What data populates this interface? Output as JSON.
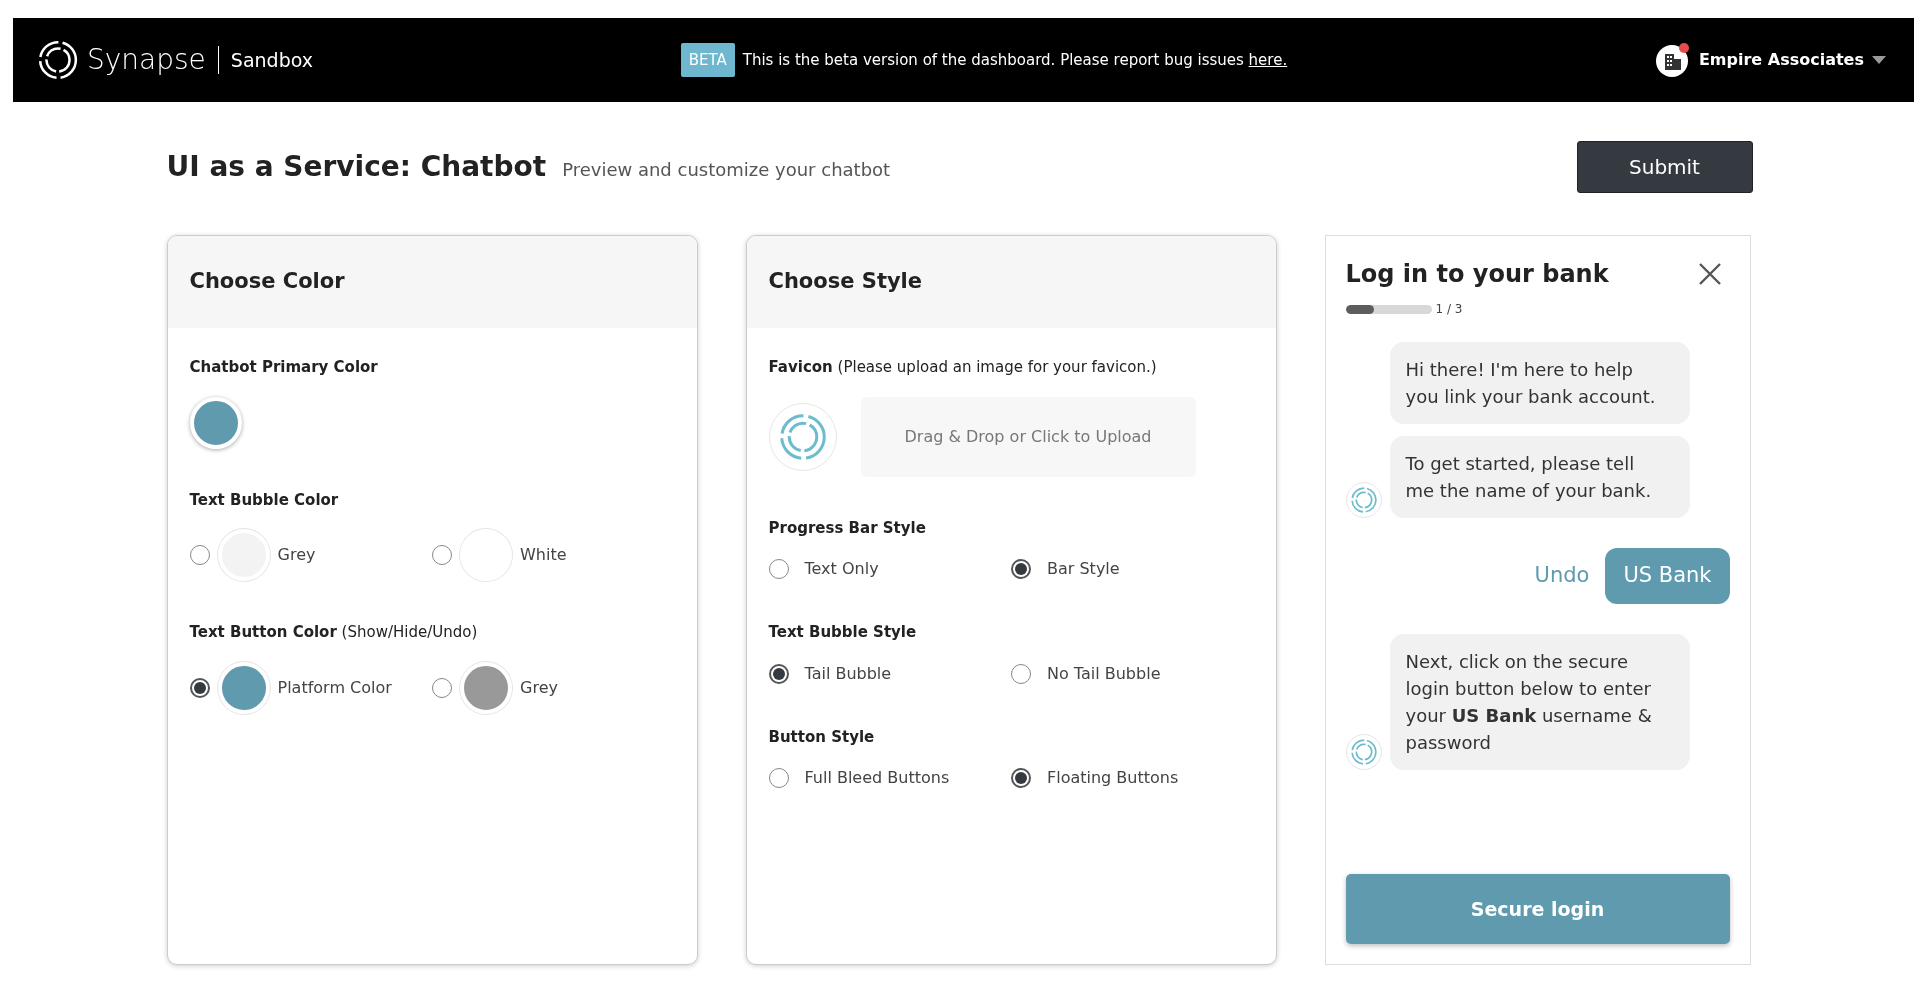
{
  "header": {
    "brand": "Synapse",
    "environment": "Sandbox",
    "beta_badge": "BETA",
    "notice": "This is the beta version of the dashboard. Please report bug issues ",
    "notice_link": "here.",
    "account": "Empire Associates"
  },
  "page": {
    "title": "UI as a Service: Chatbot",
    "subtitle": "Preview and customize your chatbot",
    "submit": "Submit"
  },
  "color_card": {
    "title": "Choose Color",
    "sections": [
      {
        "kind": "swatch",
        "label": "Chatbot Primary Color",
        "color": "#5f9aae"
      },
      {
        "kind": "options",
        "label": "Text Bubble Color",
        "options": [
          {
            "label": "Grey",
            "color": "#f3f3f3",
            "selected": false
          },
          {
            "label": "White",
            "color": "#ffffff",
            "selected": false
          }
        ]
      },
      {
        "kind": "options",
        "label": "Text Button Color",
        "note": "(Show/Hide/Undo)",
        "options": [
          {
            "label": "Platform Color",
            "color": "#5f9aae",
            "selected": true
          },
          {
            "label": "Grey",
            "color": "#999999",
            "selected": false
          }
        ]
      }
    ]
  },
  "style_card": {
    "title": "Choose Style",
    "sections": [
      {
        "kind": "upload",
        "label": "Favicon",
        "note": "(Please upload an image for your favicon.)",
        "upload_text": "Drag & Drop or Click to Upload"
      },
      {
        "kind": "options",
        "label": "Progress Bar Style",
        "options": [
          {
            "label": "Text Only",
            "selected": false
          },
          {
            "label": "Bar Style",
            "selected": true
          }
        ]
      },
      {
        "kind": "options",
        "label": "Text Bubble Style",
        "options": [
          {
            "label": "Tail Bubble",
            "selected": true
          },
          {
            "label": "No Tail Bubble",
            "selected": false
          }
        ]
      },
      {
        "kind": "options",
        "label": "Button Style",
        "options": [
          {
            "label": "Full Bleed Buttons",
            "selected": false
          },
          {
            "label": "Floating Buttons",
            "selected": true
          }
        ]
      }
    ]
  },
  "chat": {
    "title": "Log in to your bank",
    "progress": {
      "level": 0.33,
      "text": "1 / 3"
    },
    "messages": [
      {
        "kind": "bot",
        "text": "Hi there! I'm here to help you link your bank account.",
        "avatar": false
      },
      {
        "kind": "bot",
        "text": "To get started, please tell me the name of your bank.",
        "avatar": true
      },
      {
        "kind": "user",
        "text": "US Bank",
        "action": "Undo"
      },
      {
        "kind": "bot",
        "text": "Next, click on the secure login button below to enter your **US Bank** username & password",
        "avatar": true
      }
    ],
    "button": "Secure login"
  }
}
